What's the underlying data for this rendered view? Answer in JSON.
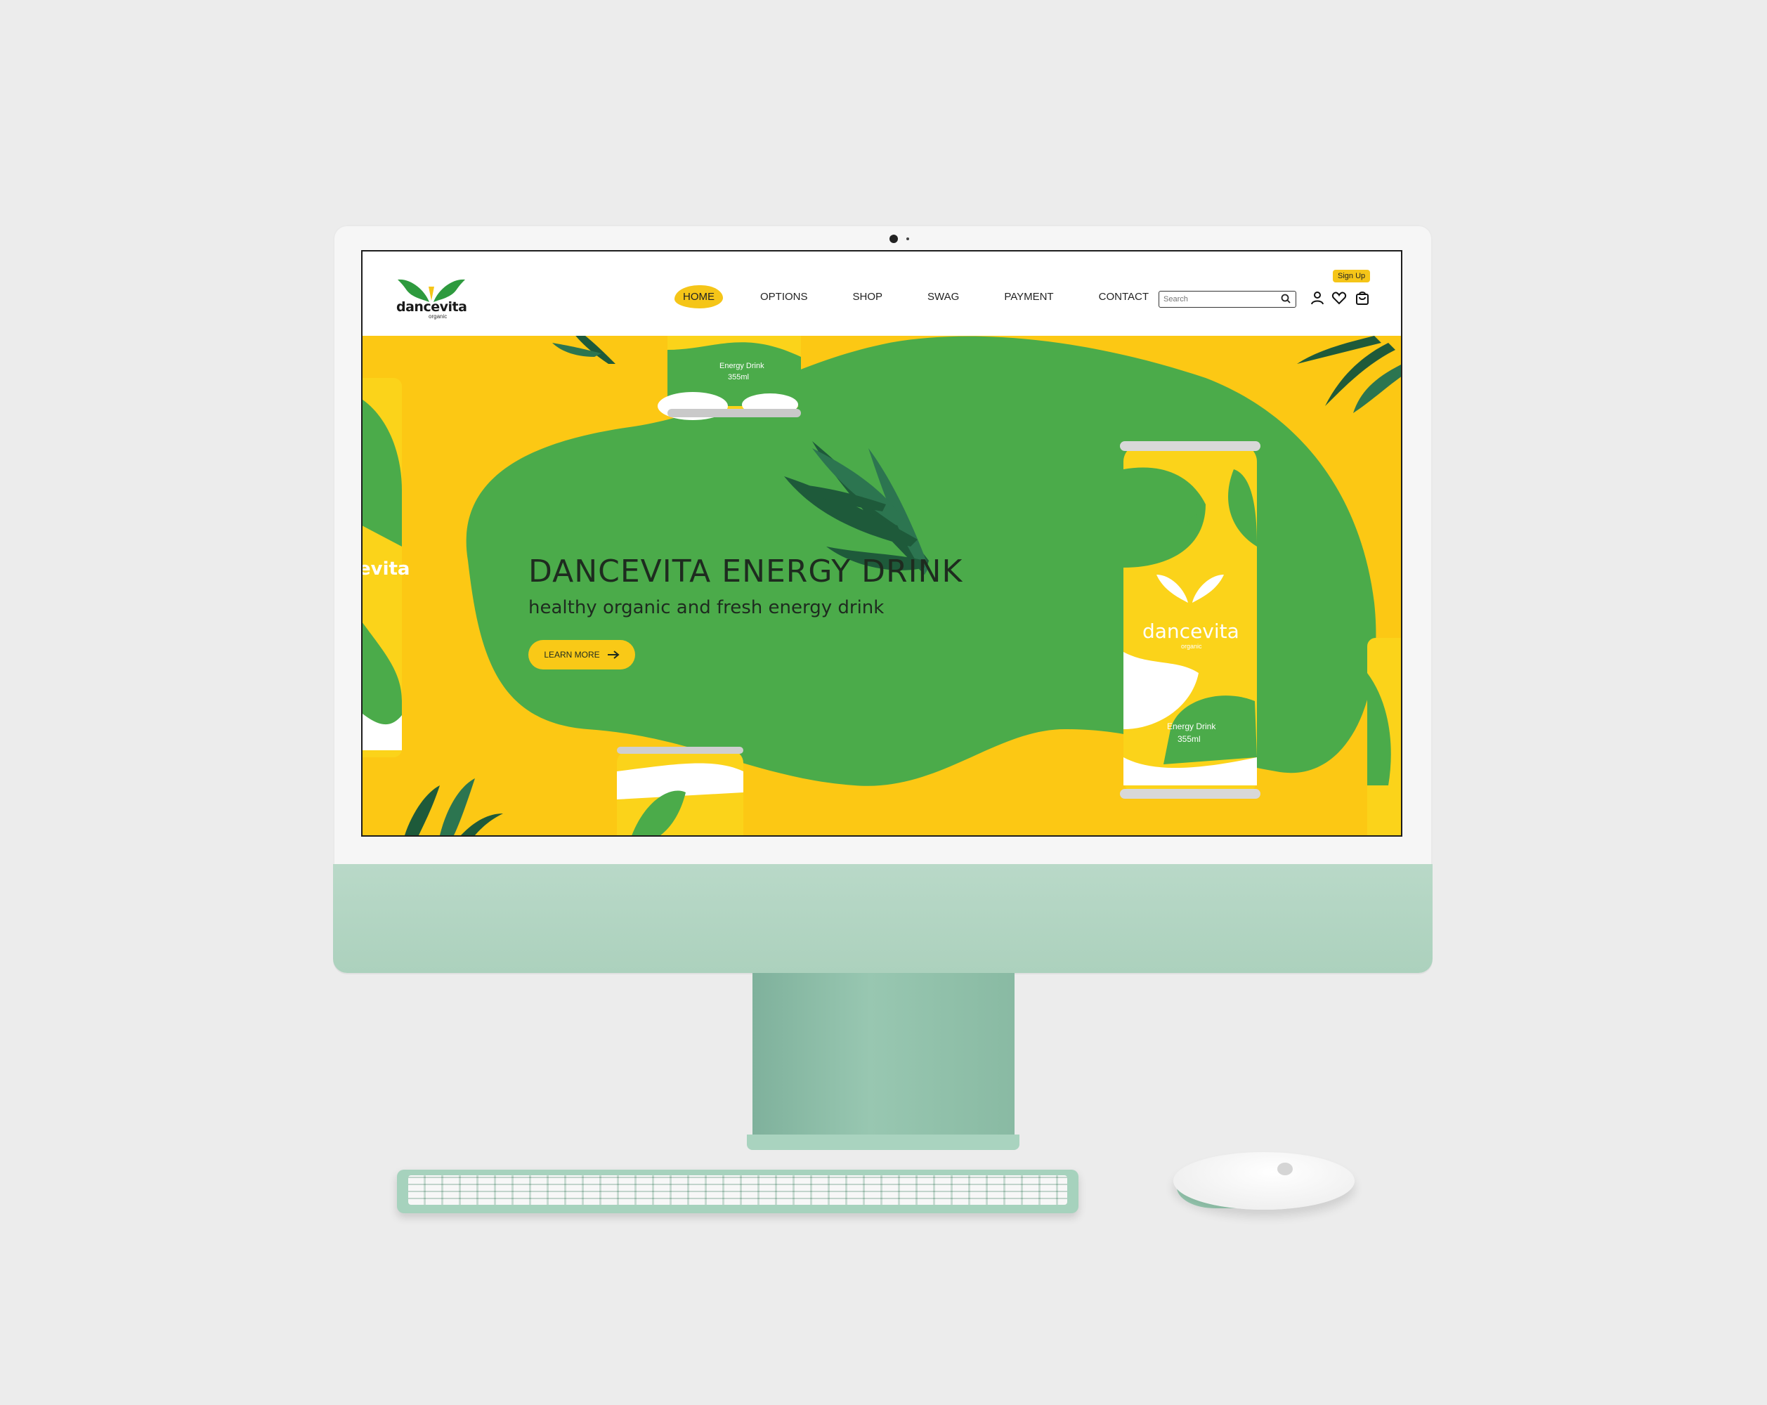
{
  "brand": {
    "name": "dancevita",
    "subtitle": "organic"
  },
  "nav": {
    "items": [
      {
        "label": "HOME",
        "active": true
      },
      {
        "label": "OPTIONS"
      },
      {
        "label": "SHOP"
      },
      {
        "label": "SWAG"
      },
      {
        "label": "PAYMENT"
      },
      {
        "label": "CONTACT"
      }
    ]
  },
  "search": {
    "placeholder": "Search"
  },
  "header_actions": {
    "signup_label": "Sign Up",
    "icons": [
      "user-icon",
      "heart-icon",
      "cart-icon"
    ]
  },
  "hero": {
    "title": "DANCEVITA ENERGY DRINK",
    "subtitle": "healthy organic and fresh energy drink",
    "cta_label": "LEARN MORE",
    "can": {
      "brand": "dancevita",
      "sub": "organic",
      "product": "Energy Drink",
      "volume": "355ml"
    },
    "can_top": {
      "product": "Energy Drink",
      "volume": "355ml"
    },
    "can_left_text": "evita"
  },
  "colors": {
    "yellow": "#fcc814",
    "green": "#4bab4a",
    "dark_leaf": "#1e5a3a",
    "chin": "#b1d6c3"
  }
}
